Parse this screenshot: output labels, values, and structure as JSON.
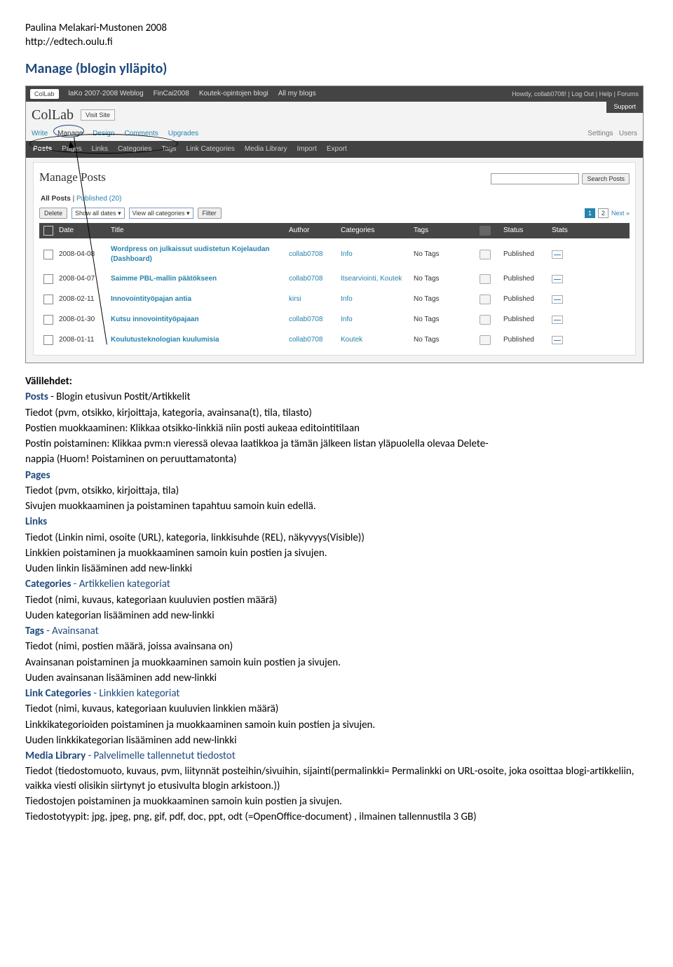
{
  "header": {
    "author": "Paulina Melakari-Mustonen 2008",
    "url": "http://edtech.oulu.fi"
  },
  "title": "Manage (blogin ylläpito)",
  "screenshot": {
    "topbar": {
      "app": "ColLab",
      "items": [
        "laKo 2007-2008 Weblog",
        "FinCai2008",
        "Koutek-opintojen blogi",
        "All my blogs"
      ],
      "right": "Howdy, collab0708! | Log Out | Help | Forums"
    },
    "support_tab": "Support",
    "brand": "ColLab",
    "visit": "Visit Site",
    "mainmenu": [
      "Write",
      "Manage",
      "Design",
      "Comments",
      "Upgrades"
    ],
    "rightmenu": [
      "Settings",
      "Users"
    ],
    "subtabs": [
      "Posts",
      "Pages",
      "Links",
      "Categories",
      "Tags",
      "Link Categories",
      "Media Library",
      "Import",
      "Export"
    ],
    "panel_title": "Manage Posts",
    "all_line": {
      "a": "All Posts",
      "b": " | ",
      "c": "Published (20)"
    },
    "filter": {
      "delete": "Delete",
      "dates": "Show all dates",
      "cats": "View all categories",
      "filter": "Filter",
      "p1": "1",
      "p2": "2",
      "next": "Next »"
    },
    "search": {
      "placeholder": "",
      "btn": "Search Posts"
    },
    "thead": [
      "",
      "Date",
      "Title",
      "Author",
      "Categories",
      "Tags",
      "",
      "Status",
      "Stats"
    ],
    "rows": [
      {
        "date": "2008-04-08",
        "title": "Wordpress on julkaissut uudistetun Kojelaudan (Dashboard)",
        "author": "collab0708",
        "cats": "Info",
        "tags": "No Tags",
        "status": "Published"
      },
      {
        "date": "2008-04-07",
        "title": "Saimme PBL-mallin päätökseen",
        "author": "collab0708",
        "cats": "Itsearviointi, Koutek",
        "tags": "No Tags",
        "status": "Published"
      },
      {
        "date": "2008-02-11",
        "title": "Innovointityöpajan antia",
        "author": "kirsi",
        "cats": "Info",
        "tags": "No Tags",
        "status": "Published"
      },
      {
        "date": "2008-01-30",
        "title": "Kutsu innovointityöpajaan",
        "author": "collab0708",
        "cats": "Info",
        "tags": "No Tags",
        "status": "Published"
      },
      {
        "date": "2008-01-11",
        "title": "Koulutusteknologian kuulumisia",
        "author": "collab0708",
        "cats": "Koutek",
        "tags": "No Tags",
        "status": "Published"
      }
    ]
  },
  "body": {
    "valilehdet": "Välilehdet:",
    "posts_h": "Posts",
    "posts_h_tail": " - Blogin etusivun Postit/Artikkelit",
    "p1": "Tiedot (pvm, otsikko, kirjoittaja, kategoria, avainsana(t), tila, tilasto)",
    "p2": "Postien muokkaaminen: Klikkaa otsikko-linkkiä niin posti aukeaa editointitilaan",
    "p3a": "Postin poistaminen: Klikkaa pvm:n vieressä olevaa laatikkoa ja tämän jälkeen listan yläpuolella olevaa Delete-",
    "p3b": "nappia (Huom! ",
    "p3c": "Poistaminen on peruuttamatonta",
    "p3d": ")",
    "pages_h": "Pages",
    "pages1": "Tiedot (pvm, otsikko, kirjoittaja, tila)",
    "pages2": "Sivujen muokkaaminen ja poistaminen tapahtuu samoin kuin edellä.",
    "links_h": "Links",
    "links1": "Tiedot (Linkin nimi, osoite (URL), kategoria, linkkisuhde (REL), näkyvyys(Visible))",
    "links2": "Linkkien poistaminen ja muokkaaminen samoin kuin postien ja sivujen.",
    "links3": "Uuden linkin lisääminen add new-linkki",
    "cat_h": "Categories",
    "cat_tail": " - Artikkelien kategoriat",
    "cat1": "Tiedot (nimi, kuvaus, kategoriaan kuuluvien postien määrä)",
    "cat2": "Uuden kategorian lisääminen add new-linkki",
    "tags_h": "Tags",
    "tags_tail": " - Avainsanat",
    "tags1": "Tiedot (nimi, postien määrä, joissa avainsana on)",
    "tags2": "Avainsanan poistaminen ja muokkaaminen samoin kuin postien ja sivujen.",
    "tags3": "Uuden avainsanan lisääminen add new-linkki",
    "lc_h": "Link Categories",
    "lc_tail": " - Linkkien kategoriat",
    "lc1": "Tiedot (nimi, kuvaus, kategoriaan kuuluvien linkkien määrä)",
    "lc2": "Linkkikategorioiden poistaminen ja muokkaaminen samoin kuin postien ja sivujen.",
    "lc3": "Uuden linkkikategorian lisääminen add new-linkki",
    "ml_h": "Media Library",
    "ml_tail": " - Palvelimelle tallennetut tiedostot",
    "ml1": "Tiedot (tiedostomuoto, kuvaus, pvm, liitynnät posteihin/sivuihin, sijainti(permalinkki= Permalinkki on URL-osoite, joka osoittaa blogi-artikkeliin, vaikka viesti olisikin siirtynyt jo etusivulta blogin arkistoon.))",
    "ml2": "Tiedostojen poistaminen ja muokkaaminen samoin kuin postien ja sivujen.",
    "ml3": "Tiedostotyypit: jpg, jpeg, png, gif, pdf, doc, ppt, odt (=OpenOffice-document) , ilmainen tallennustila 3 GB)"
  }
}
